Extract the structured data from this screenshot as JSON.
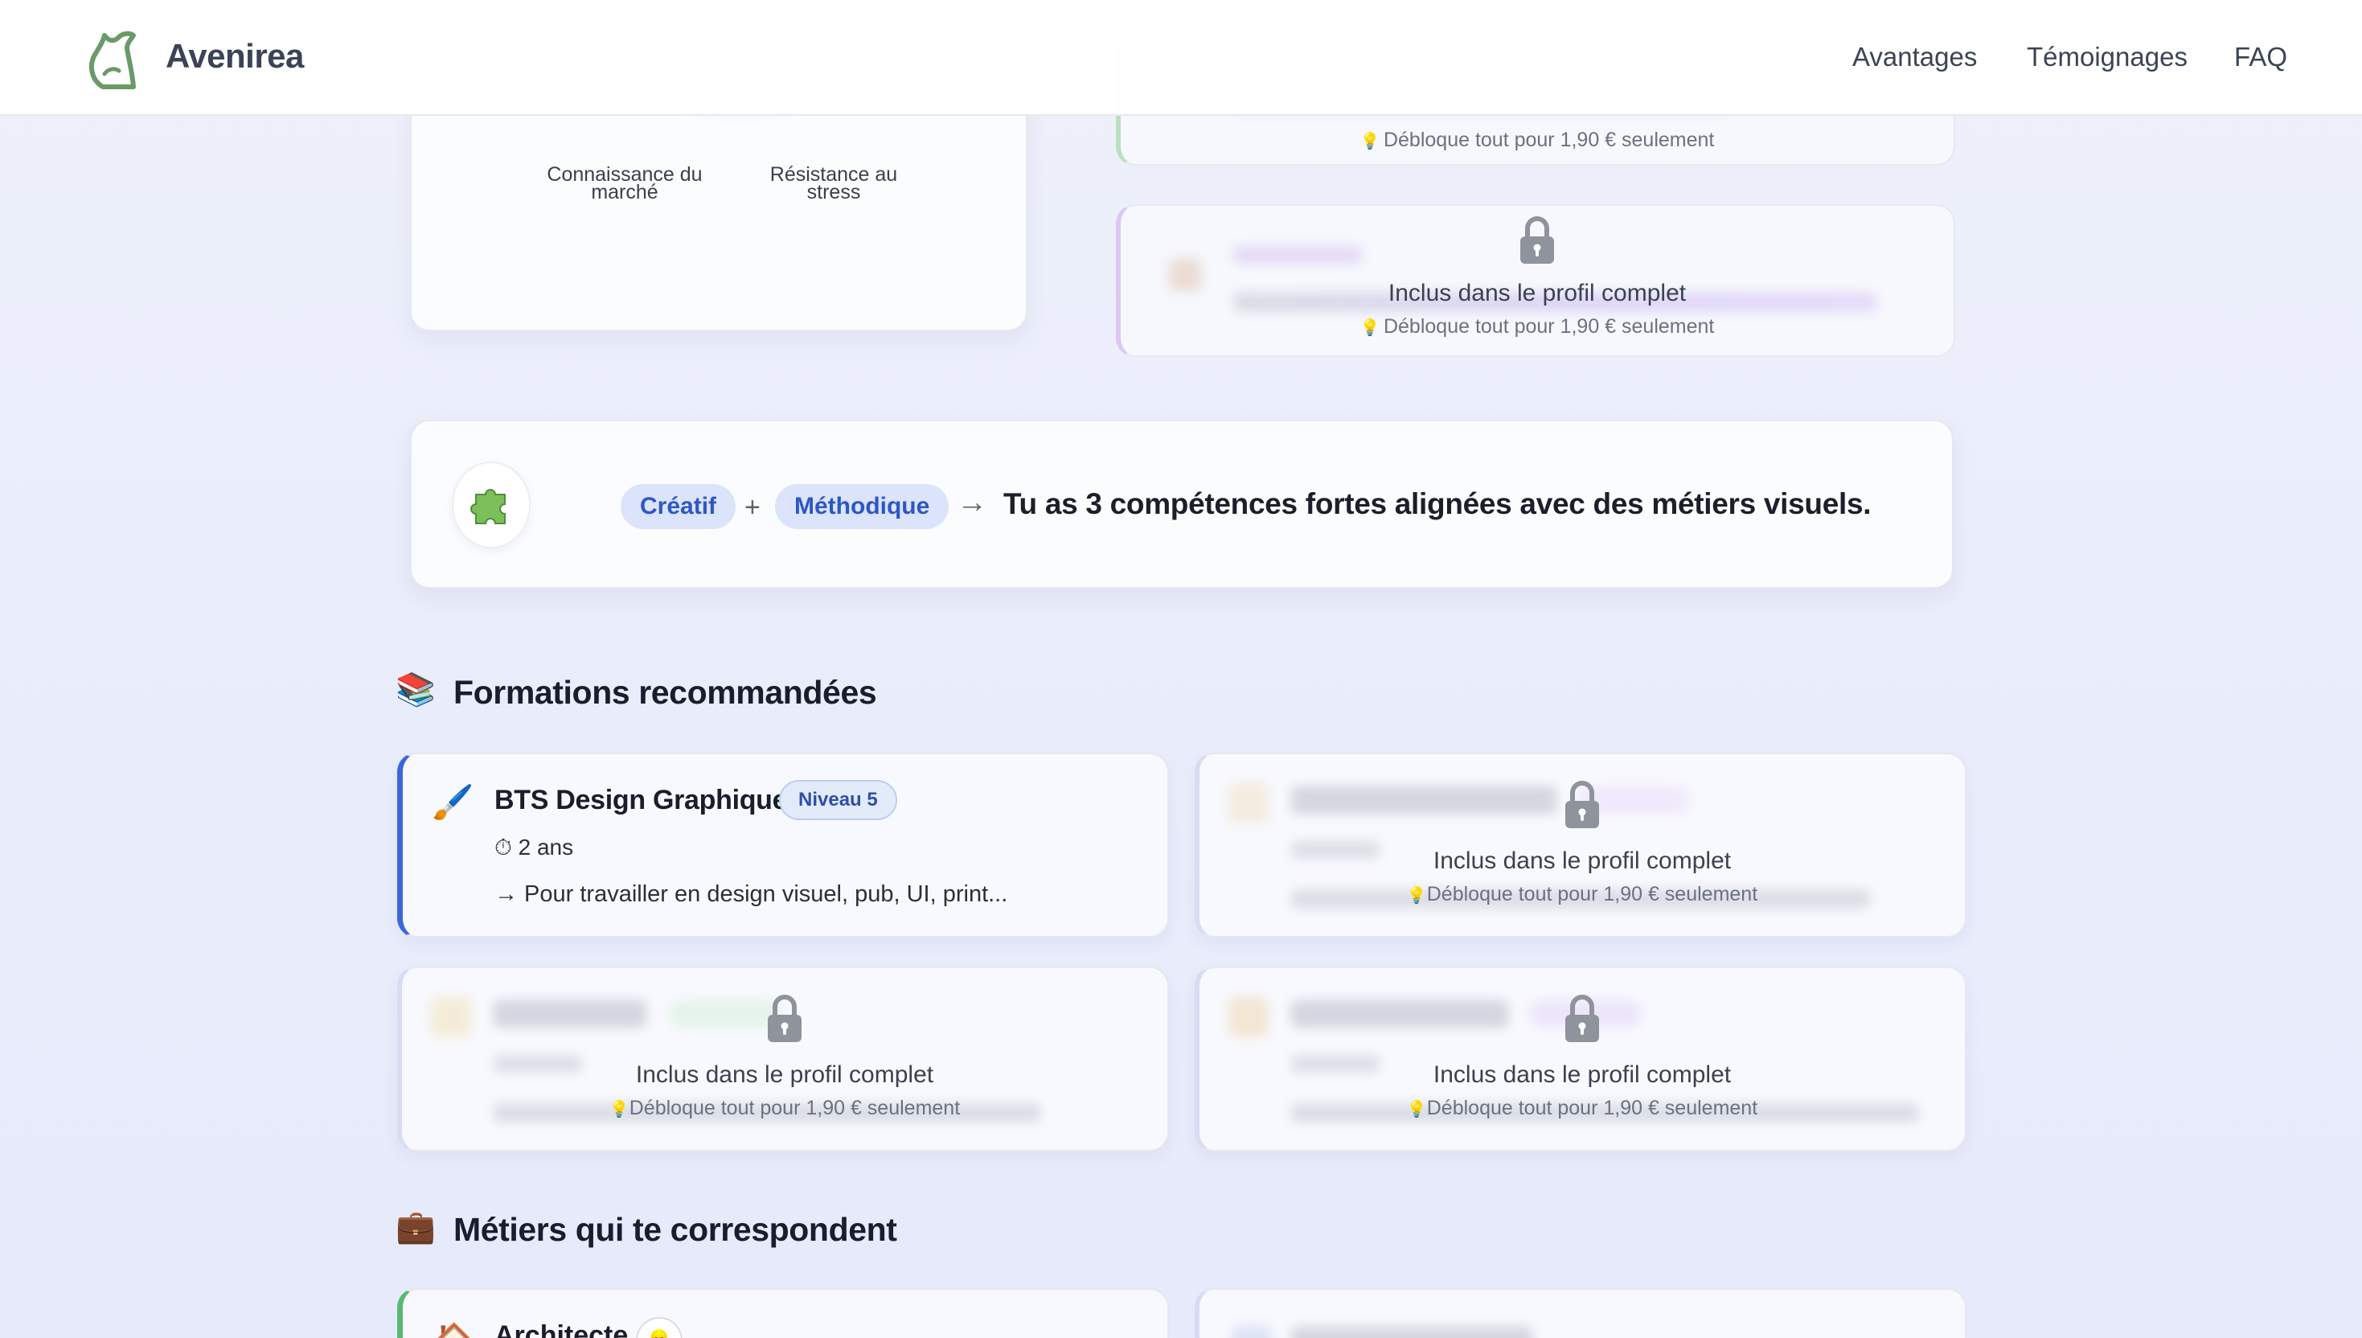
{
  "brand": {
    "name": "Avenirea",
    "accent": "#6a9a68"
  },
  "nav": {
    "links": [
      "Avantages",
      "Témoignages",
      "FAQ"
    ]
  },
  "radar": {
    "labels": [
      "Connaissance du marché",
      "Résistance au stress"
    ]
  },
  "locked": {
    "title": "Inclus dans le profil complet",
    "subtitle": "Débloque tout pour 1,90 € seulement",
    "lock_icon": "lock-icon",
    "bulb_icon": "bulb-icon"
  },
  "insight": {
    "icon": "🧩",
    "tags": [
      "Créatif",
      "Méthodique"
    ],
    "plus": "+",
    "arrow": "→",
    "text": "Tu as 3 compétences fortes alignées avec des métiers visuels."
  },
  "formations": {
    "heading": "Formations recommandées",
    "icon": "📚",
    "items": [
      {
        "icon": "🖌️",
        "title": "BTS Design Graphique",
        "badge": "Niveau 5",
        "duration": "⏱ 2 ans",
        "desc": "→ Pour travailler en design visuel, pub, UI, print..."
      }
    ]
  },
  "metiers": {
    "heading": "Métiers qui te correspondent",
    "icon": "💼",
    "items": [
      {
        "icon": "🏠",
        "title": "Architecte",
        "badge": "👷"
      }
    ]
  },
  "colors": {
    "tag_bg": "#dbe4fb",
    "tag_text": "#2d57c4",
    "active_border": "#3d67d8",
    "metier_border": "#5bb870"
  }
}
